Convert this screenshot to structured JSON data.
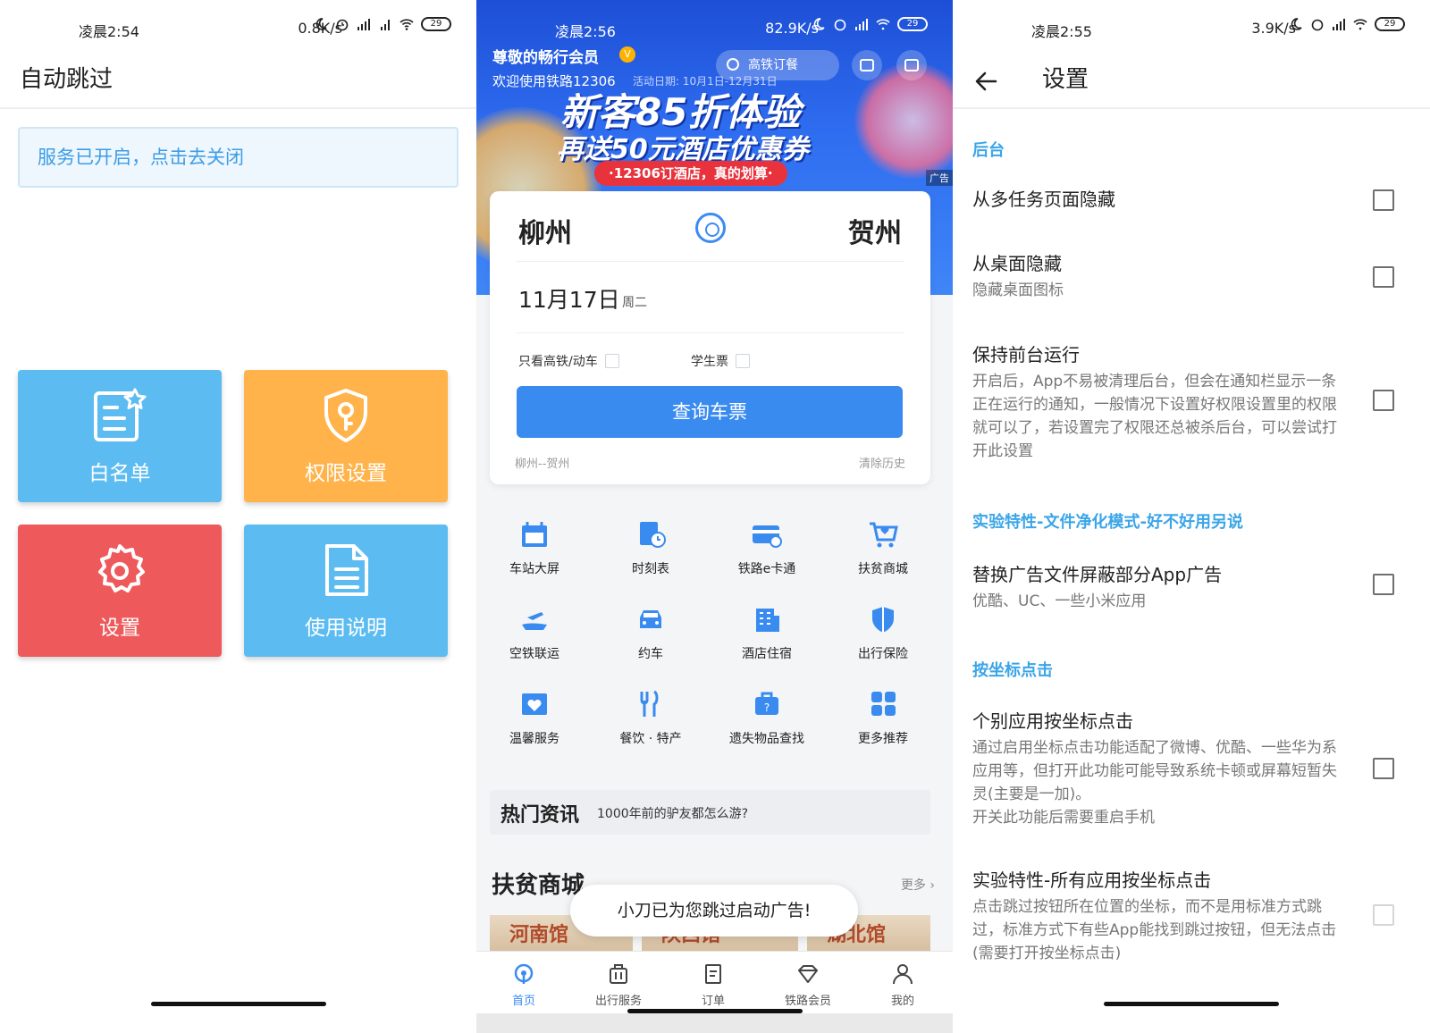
{
  "left": {
    "status": {
      "time": "凌晨2:54",
      "net": "0.8K/s",
      "battery": "29"
    },
    "title": "自动跳过",
    "service_banner": "服务已开启，点击去关闭",
    "tiles": {
      "whitelist": "白名单",
      "permission": "权限设置",
      "settings": "设置",
      "manual": "使用说明"
    }
  },
  "middle": {
    "status": {
      "time": "凌晨2:56",
      "net": "82.9K/s",
      "battery": "29"
    },
    "member_title": "尊敬的畅行会员",
    "member_badge": "V",
    "welcome": "欢迎使用铁路12306",
    "activity_date": "活动日期: 10月1日-12月31日",
    "search_placeholder": "高铁订餐",
    "promo_line1": "新客85折体验",
    "promo_line2": "再送50元酒店优惠券",
    "promo_line3": "·12306订酒店，真的划算·",
    "ad_tag": "广告",
    "from_city": "柳州",
    "to_city": "贺州",
    "date": "11月17日",
    "weekday": "周二",
    "only_high_speed": "只看高铁/动车",
    "student_ticket": "学生票",
    "query_button": "查询车票",
    "history": "柳州--贺州",
    "clear_history": "清除历史",
    "services": [
      "车站大屏",
      "时刻表",
      "铁路e卡通",
      "扶贫商城",
      "空铁联运",
      "约车",
      "酒店住宿",
      "出行保险",
      "温馨服务",
      "餐饮 · 特产",
      "遗失物品查找",
      "更多推荐"
    ],
    "hot_news_title": "热门资讯",
    "hot_news_text": "1000年前的驴友都怎么游?",
    "mall_title": "扶贫商城",
    "mall_more": "更多",
    "mall_images": [
      "河南馆",
      "陕西馆",
      "湖北馆"
    ],
    "toast": "小刀已为您跳过启动广告!",
    "nav": [
      "首页",
      "出行服务",
      "订单",
      "铁路会员",
      "我的"
    ]
  },
  "right": {
    "status": {
      "time": "凌晨2:55",
      "net": "3.9K/s",
      "battery": "29"
    },
    "title": "设置",
    "sections": {
      "background": "后台",
      "experimental_file": "实验特性-文件净化模式-好不好用另说",
      "coord_click": "按坐标点击"
    },
    "prefs": {
      "hide_recents": {
        "title": "从多任务页面隐藏"
      },
      "hide_desktop": {
        "title": "从桌面隐藏",
        "summary": "隐藏桌面图标"
      },
      "keep_foreground": {
        "title": "保持前台运行",
        "summary": "开启后，App不易被清理后台，但会在通知栏显示一条正在运行的通知，一般情况下设置好权限设置里的权限就可以了，若设置完了权限还总被杀后台，可以尝试打开此设置"
      },
      "replace_ad_file": {
        "title": "替换广告文件屏蔽部分App广告",
        "summary": "优酷、UC、一些小米应用"
      },
      "app_coord_click": {
        "title": "个别应用按坐标点击",
        "summary": "通过启用坐标点击功能适配了微博、优酷、一些华为系应用等，但打开此功能可能导致系统卡顿或屏幕短暂失灵(主要是一加)。",
        "summary2": "开关此功能后需要重启手机"
      },
      "all_coord_click": {
        "title": "实验特性-所有应用按坐标点击",
        "summary": "点击跳过按钮所在位置的坐标，而不是用标准方式跳过，标准方式下有些App能找到跳过按钮，但无法点击(需要打开按坐标点击)"
      }
    }
  }
}
